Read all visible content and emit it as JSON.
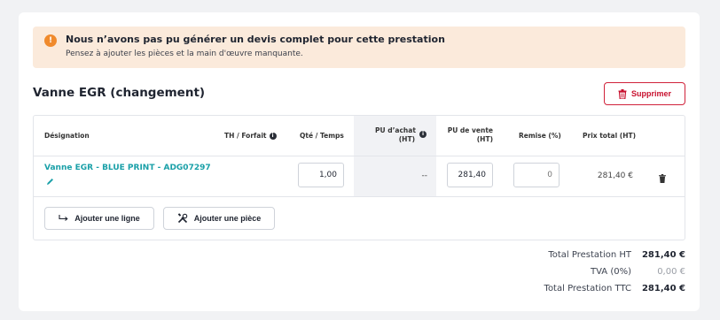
{
  "alert": {
    "title": "Nous n’avons pas pu générer un devis complet pour cette prestation",
    "message": "Pensez à ajouter les pièces et la main d'œuvre manquante."
  },
  "section": {
    "title": "Vanne EGR (changement)",
    "delete_label": "Supprimer"
  },
  "table": {
    "headers": {
      "designation": "Désignation",
      "th_forfait": "TH / Forfait",
      "qty_time": "Qté / Temps",
      "pu_achat_line1": "PU d’achat",
      "pu_achat_line2": "(HT)",
      "pu_vente_line1": "PU de vente",
      "pu_vente_line2": "(HT)",
      "remise": "Remise (%)",
      "prix_total": "Prix total (HT)"
    },
    "row": {
      "designation": "Vanne EGR - BLUE PRINT - ADG07297",
      "quantity": "1,00",
      "pu_achat": "--",
      "pu_vente": "281,40",
      "remise_placeholder": "0",
      "prix_total": "281,40 €"
    },
    "add_line_label": "Ajouter une ligne",
    "add_part_label": "Ajouter une pièce"
  },
  "totals": {
    "ht_label": "Total Prestation HT",
    "ht_value": "281,40 €",
    "tva_label": "TVA (0%)",
    "tva_value": "0,00 €",
    "ttc_label": "Total Prestation TTC",
    "ttc_value": "281,40 €"
  },
  "colors": {
    "accent_teal": "#1aa0a8",
    "danger_red": "#c8102e",
    "alert_bg": "#fbeadb",
    "alert_icon": "#f08a2c"
  }
}
